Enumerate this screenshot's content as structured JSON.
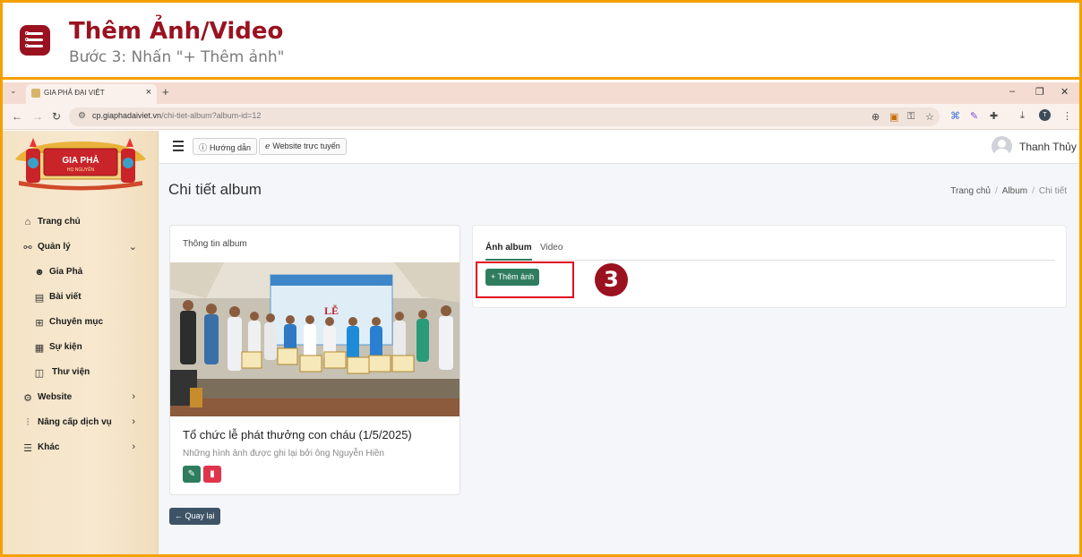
{
  "header": {
    "title": "Thêm Ảnh/Video",
    "subtitle": "Bước 3: Nhấn \"+ Thêm ảnh\""
  },
  "browser": {
    "tab_title": "GIA PHẢ ĐẠI VIỆT",
    "url_host": "cp.giaphadaivie t.vn",
    "url_full": "cp.giaphadaiviet.vn",
    "url_path": "/chi-tiet-album?album-id=12",
    "profile_initial": "T"
  },
  "sidebar": {
    "logo_line1": "GIA PHẢ",
    "logo_line2": "HỌ NGUYỄN",
    "items": [
      {
        "label": "Trang chủ",
        "icon": "home-icon"
      },
      {
        "label": "Quản lý",
        "icon": "sitemap-icon"
      },
      {
        "label": "Gia Phả",
        "icon": "users-icon"
      },
      {
        "label": "Bài viết",
        "icon": "newspaper-icon"
      },
      {
        "label": "Chuyên mục",
        "icon": "table-icon"
      },
      {
        "label": "Sự kiện",
        "icon": "calendar-icon"
      },
      {
        "label": "Thư viện",
        "icon": "images-icon"
      },
      {
        "label": "Website",
        "icon": "gear-icon"
      },
      {
        "label": "Nâng cấp dịch vụ",
        "icon": "chart-icon"
      },
      {
        "label": "Khác",
        "icon": "list-icon"
      }
    ]
  },
  "topbar": {
    "guide_label": "Hướng dẫn",
    "website_label": "Website trực tuyến",
    "user_name": "Thanh Thủy"
  },
  "page": {
    "title": "Chi tiết album",
    "breadcrumb": [
      "Trang chủ",
      "Album",
      "Chi tiết"
    ]
  },
  "album_card": {
    "header": "Thông tin album",
    "caption": "Tổ chức lễ phát thưởng con cháu (1/5/2025)",
    "description": "Những hình ảnh được ghi lại bởi ông Nguyễn Hiền",
    "banner_text": "LỄ"
  },
  "media_card": {
    "tab_photos": "Ảnh album",
    "tab_video": "Video",
    "add_button": "+ Thêm ảnh"
  },
  "back_button": "← Quay lại",
  "step_number": "3",
  "colors": {
    "accent_red": "#9a1220",
    "frame_orange": "#f5a000",
    "primary_green": "#2f7d5e",
    "danger": "#e0344d"
  }
}
